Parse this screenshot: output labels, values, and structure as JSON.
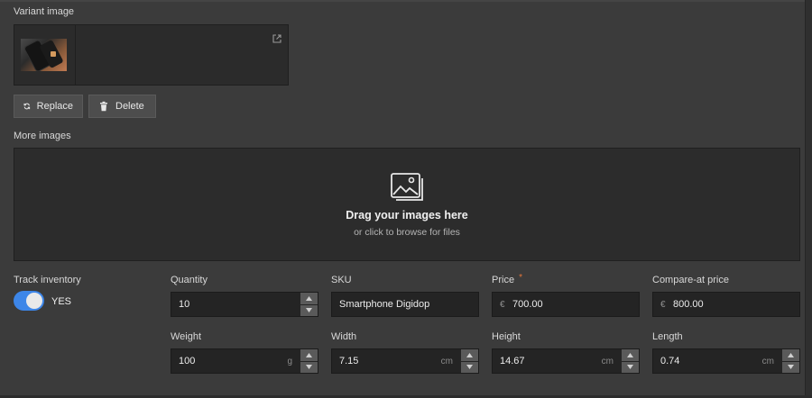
{
  "variant_image": {
    "label": "Variant image",
    "external_link_icon": "external-link-icon"
  },
  "buttons": {
    "replace_label": "Replace",
    "delete_label": "Delete"
  },
  "more_images": {
    "label": "More images",
    "dropzone_title": "Drag your images here",
    "dropzone_subtitle": "or click to browse for files",
    "icon": "images-icon"
  },
  "inventory": {
    "track_label": "Track inventory",
    "toggle_state": "YES",
    "quantity_label": "Quantity",
    "quantity_value": "10",
    "sku_label": "SKU",
    "sku_value": "Smartphone Digidop",
    "price_label": "Price",
    "price_required": "*",
    "price_currency": "€",
    "price_value": "700.00",
    "compare_label": "Compare-at price",
    "compare_currency": "€",
    "compare_value": "800.00"
  },
  "dimensions": {
    "weight_label": "Weight",
    "weight_value": "100",
    "weight_unit": "g",
    "width_label": "Width",
    "width_value": "7.15",
    "width_unit": "cm",
    "height_label": "Height",
    "height_value": "14.67",
    "height_unit": "cm",
    "length_label": "Length",
    "length_value": "0.74",
    "length_unit": "cm"
  },
  "colors": {
    "background": "#3b3b3b",
    "field": "#242424",
    "toggle_on": "#3d86e8",
    "required": "#e2763a"
  }
}
